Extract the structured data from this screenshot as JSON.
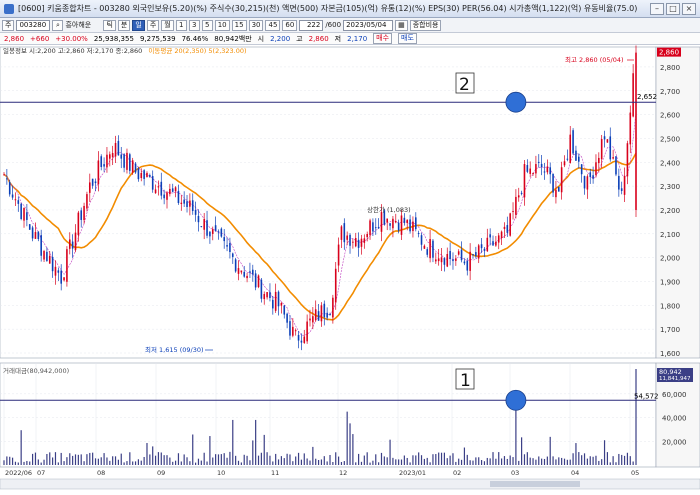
{
  "window": {
    "title": "[0600] 키움종합차트 - 003280 외국인보유(5.20)(%) 주식수(30,215)(천) 액면(500) 자본금(105)(억) 유통(12)(%) EPS(30) PER(56.04) 시가총액(1,122)(억) 유동비율(75.0)",
    "controls": [
      "–",
      "□",
      "×"
    ]
  },
  "toolbar": {
    "stock_code": "003280",
    "stock_name": "흥아해운",
    "tabs": [
      "주",
      "틱",
      "분",
      "일",
      "주",
      "월",
      "년"
    ],
    "period_buttons": [
      "1",
      "3",
      "5",
      "10",
      "15",
      "30",
      "45",
      "60"
    ],
    "count_value": "222",
    "count_total": "/600",
    "date_value": "2023/05/04",
    "mode_buttons": [
      "종합비용"
    ]
  },
  "quote": {
    "price": "2,860",
    "change": "+660",
    "change_pct": "+30.00%",
    "volume": "25,938,355",
    "amount": "9,275,539",
    "ratio": "76.46%",
    "traded_value": "80,942백만",
    "fields": [
      "시",
      "2,200",
      "고",
      "2,860",
      "저",
      "2,170"
    ],
    "buy_sell": [
      "매수",
      "매도"
    ]
  },
  "legend": {
    "price_info": "일봉정보 시:2,200 고:2,860 저:2,170 종:2,860",
    "ma_info": "이동평균 20(2,350) 5(2,323.00)",
    "volume_info": "거래대금(80,942,000)"
  },
  "chart_data": [
    {
      "type": "candlestick",
      "title": "",
      "ylim": [
        1600,
        2850
      ],
      "y_ticks": [
        "2,800",
        "2,700",
        "2,600",
        "2,500",
        "2,400",
        "2,300",
        "2,200",
        "2,100",
        "2,000",
        "1,900",
        "1,800",
        "1,700",
        "1,600"
      ],
      "hline": {
        "value": 2652,
        "label": "2,652"
      },
      "annotations": [
        {
          "text": "최고 2,860 (05/04)",
          "color": "#d8001b"
        },
        {
          "text": "최저 1,615 (09/30)",
          "color": "#0b3fb8"
        },
        {
          "text": "상한가 (1,083)",
          "color": "#333333"
        },
        {
          "text": "2",
          "style": "boxed-number"
        }
      ],
      "last_price_label": "2,860",
      "x_ticks": [
        "2022/06",
        "07",
        "08",
        "09",
        "10",
        "11",
        "12",
        "2023/01",
        "02",
        "03",
        "04",
        "05"
      ],
      "series": [
        {
          "name": "5일선",
          "color": "#c040c0"
        },
        {
          "name": "20일선",
          "color": "#f28c00"
        }
      ]
    },
    {
      "type": "bar",
      "title": "",
      "ylim": [
        0,
        80942
      ],
      "y_ticks": [
        "60,000",
        "40,000",
        "20,000"
      ],
      "hline": {
        "value": 54572,
        "label": "54,572"
      },
      "last_value_label": "80,942",
      "last_value_label2": "11,841,947",
      "annotations": [
        {
          "text": "1",
          "style": "boxed-number"
        }
      ]
    }
  ],
  "colors": {
    "up": "#d8001b",
    "down": "#0b3fb8",
    "ma20": "#f28c00",
    "ma5": "#c040c0",
    "hline": "#2a2a7a",
    "marker": "#2f6fd6"
  }
}
